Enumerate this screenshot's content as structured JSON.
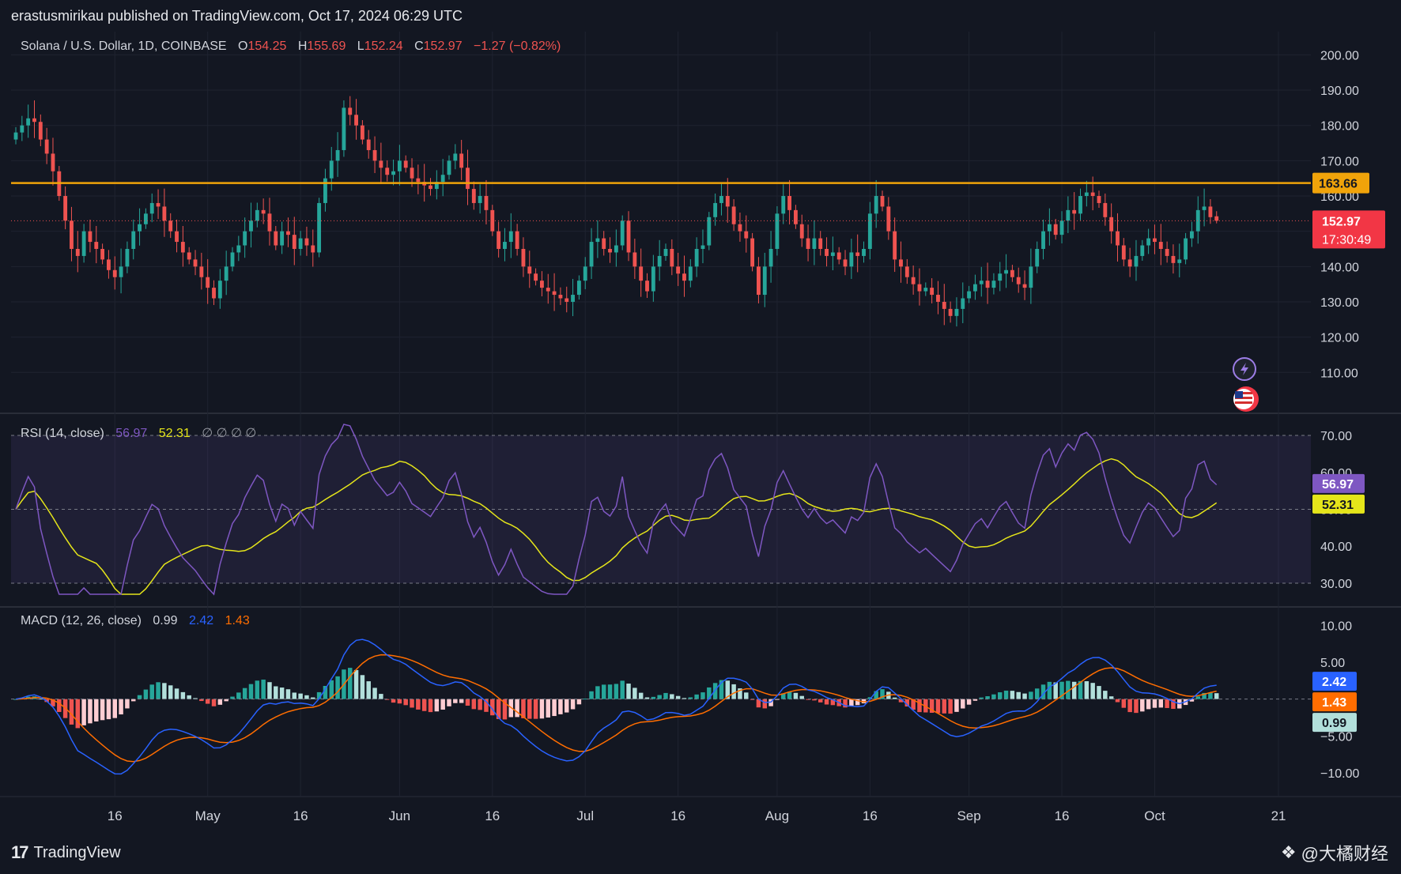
{
  "header": {
    "publisher": "erastusmirikau published on TradingView.com, Oct 17, 2024 06:29 UTC"
  },
  "footer": {
    "brand": "TradingView",
    "watermark": "@大橘财经"
  },
  "colors": {
    "bg": "#131722",
    "up": "#26a69a",
    "down": "#ef5350",
    "resistance": "#f0a30a",
    "rsi": "#7e57c2",
    "rsi_ma": "#e5e51a",
    "macd": "#2962ff",
    "signal": "#ff6d00",
    "hist_up_strong": "#26a69a",
    "hist_up_weak": "#b2dfdb",
    "hist_down_strong": "#ef5350",
    "hist_down_weak": "#ffcdd2"
  },
  "icons": {
    "bolt": "lightning-bolt-icon",
    "flag": "us-flag-icon",
    "logo": "tradingview-logo-icon",
    "watermark": "diamond-logo-icon"
  },
  "chart_data": [
    {
      "type": "candlestick",
      "legend": {
        "symbol": "Solana / U.S. Dollar, 1D, COINBASE",
        "o_label": "O",
        "o": "154.25",
        "h_label": "H",
        "h": "155.69",
        "l_label": "L",
        "l": "152.24",
        "c_label": "C",
        "c": "152.97",
        "change": "−1.27 (−0.82%)"
      },
      "y_ticks": [
        "200.00",
        "190.00",
        "180.00",
        "170.00",
        "160.00",
        "150.00",
        "140.00",
        "130.00",
        "120.00",
        "110.00"
      ],
      "y_tick_values": [
        200,
        190,
        180,
        170,
        160,
        150,
        140,
        130,
        120,
        110
      ],
      "ylim": [
        102,
        203
      ],
      "resistance": {
        "value": 163.66,
        "label": "163.66"
      },
      "last_price": {
        "value": 152.97,
        "label": "152.97",
        "countdown": "17:30:49"
      },
      "closes": [
        178,
        180,
        182,
        181,
        176,
        172,
        167,
        160,
        153,
        145,
        143,
        150,
        147,
        145,
        142,
        139,
        137,
        140,
        145,
        150,
        152,
        155,
        158,
        157,
        153,
        150,
        147,
        144,
        142,
        140,
        137,
        134,
        131,
        136,
        140,
        144,
        146,
        150,
        153,
        156,
        155,
        150,
        146,
        150,
        149,
        145,
        148,
        146,
        144,
        158,
        165,
        170,
        173,
        185,
        183,
        180,
        176,
        173,
        170,
        168,
        166,
        167,
        170,
        168,
        165,
        164,
        163,
        162,
        164,
        166,
        170,
        172,
        168,
        162,
        158,
        160,
        156,
        150,
        145,
        147,
        150,
        145,
        140,
        138,
        136,
        134,
        133,
        132,
        131,
        130,
        132,
        136,
        140,
        147,
        148,
        145,
        144,
        146,
        153,
        144,
        140,
        136,
        133,
        140,
        143,
        145,
        140,
        138,
        136,
        140,
        145,
        146,
        154,
        158,
        160,
        157,
        152,
        150,
        148,
        140,
        132,
        140,
        145,
        155,
        160,
        156,
        152,
        148,
        145,
        148,
        145,
        143,
        144,
        142,
        140,
        144,
        143,
        145,
        155,
        160,
        157,
        150,
        142,
        140,
        137,
        135,
        133,
        134,
        132,
        130,
        128,
        126,
        128,
        131,
        133,
        135,
        136,
        134,
        136,
        138,
        139,
        137,
        135,
        134,
        140,
        145,
        150,
        152,
        149,
        153,
        156,
        155,
        160,
        161,
        160,
        158,
        154,
        150,
        146,
        142,
        140,
        143,
        146,
        148,
        147,
        145,
        143,
        141,
        142,
        148,
        150,
        156,
        157,
        154,
        153
      ],
      "x_ticks": [
        {
          "label": "16",
          "i": 16
        },
        {
          "label": "May",
          "i": 31
        },
        {
          "label": "16",
          "i": 46
        },
        {
          "label": "Jun",
          "i": 62
        },
        {
          "label": "16",
          "i": 77
        },
        {
          "label": "Jul",
          "i": 92
        },
        {
          "label": "16",
          "i": 107
        },
        {
          "label": "Aug",
          "i": 123
        },
        {
          "label": "16",
          "i": 138
        },
        {
          "label": "Sep",
          "i": 154
        },
        {
          "label": "16",
          "i": 169
        },
        {
          "label": "Oct",
          "i": 184
        },
        {
          "label": "21",
          "i": 204
        }
      ]
    },
    {
      "type": "line",
      "title": "RSI (14, close)",
      "values_label": {
        "rsi": "56.97",
        "ma": "52.31",
        "extra": "∅ ∅ ∅ ∅"
      },
      "y_ticks": [
        "70.00",
        "60.00",
        "50.00",
        "40.00",
        "30.00"
      ],
      "y_tick_values": [
        70,
        60,
        50,
        40,
        30
      ],
      "ylim": [
        27,
        73
      ],
      "band": [
        30,
        70
      ],
      "rsi_last": {
        "value": 56.97,
        "label": "56.97"
      },
      "ma_last": {
        "value": 52.31,
        "label": "52.31"
      }
    },
    {
      "type": "line",
      "title": "MACD (12, 26, close)",
      "values_label": {
        "hist": "0.99",
        "macd": "2.42",
        "signal": "1.43"
      },
      "y_ticks": [
        "10.00",
        "5.00",
        "0.00",
        "−5.00",
        "−10.00"
      ],
      "y_tick_values": [
        10,
        5,
        0,
        -5,
        -10
      ],
      "ylim": [
        -11.5,
        11
      ],
      "macd_last": {
        "value": 2.42,
        "label": "2.42"
      },
      "signal_last": {
        "value": 1.43,
        "label": "1.43"
      },
      "hist_last": {
        "value": 0.99,
        "label": "0.99"
      }
    }
  ]
}
